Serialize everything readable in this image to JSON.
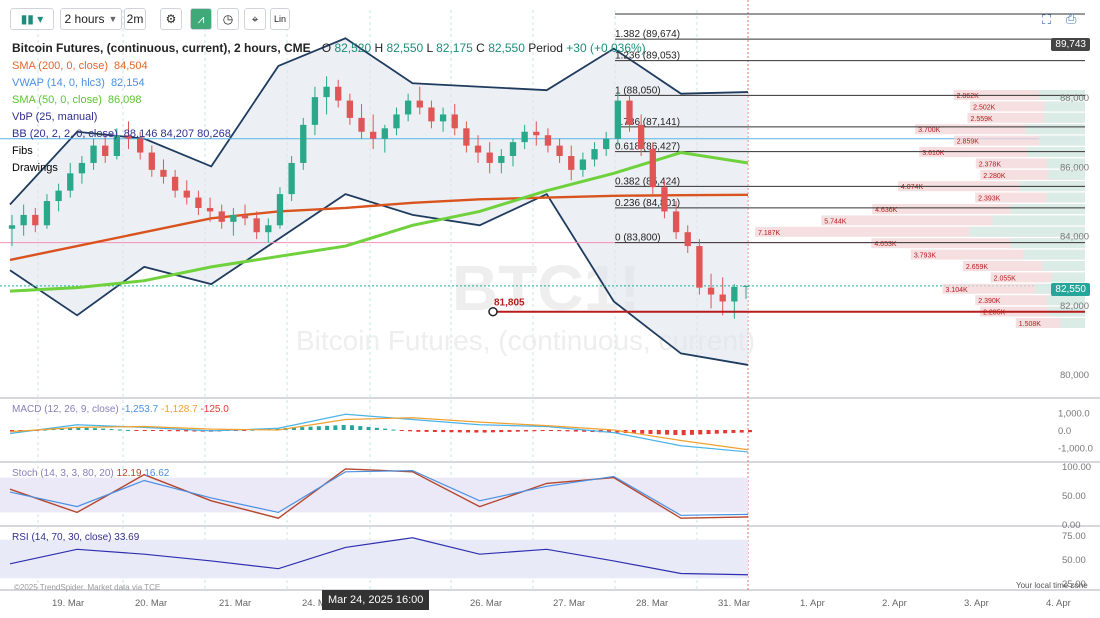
{
  "toolbar": {
    "interval_label": "2 hours",
    "interval2_label": "2m",
    "lin_label": "Lin"
  },
  "header": {
    "title": "Bitcoin Futures, (continuous, current), 2 hours, CME",
    "o_label": "O",
    "o": "82,520",
    "h_label": "H",
    "h": "82,550",
    "l_label": "L",
    "l": "82,175",
    "c_label": "C",
    "c": "82,550",
    "period_label": "Period",
    "period": "+30 (+0.036%)"
  },
  "legend": [
    {
      "name": "SMA (200, 0, close)",
      "values": "84,504",
      "color": "#e0662b"
    },
    {
      "name": "VWAP (14, 0, hlc3)",
      "values": "82,154",
      "color": "#4a90e2"
    },
    {
      "name": "SMA (50, 0, close)",
      "values": "86,098",
      "color": "#5cc431"
    },
    {
      "name": "VbP (25, manual)",
      "values": "",
      "color": "#2f2f8f"
    },
    {
      "name": "BB (20, 2, 2, 0, close)",
      "values": "88,146 84,207 80,268",
      "color": "#2f2f8f"
    },
    {
      "name": "Fibs",
      "values": "",
      "color": "#222222"
    },
    {
      "name": "Drawings",
      "values": "",
      "color": "#222222"
    }
  ],
  "watermark": {
    "symbol": "BTC1!",
    "name": "Bitcoin Futures, (continuous, current)"
  },
  "price_axis": {
    "ticks": [
      "88,000",
      "86,000",
      "84,000",
      "82,000",
      "80,000"
    ],
    "top_tag": "89,743",
    "last_tag": "82,550",
    "last_color": "#26a69a"
  },
  "fib_levels": [
    {
      "label": "1.382 (89,674)"
    },
    {
      "label": "1.236 (89,053)"
    },
    {
      "label": "1 (88,050)"
    },
    {
      "label": "0.786 (87,141)"
    },
    {
      "label": "0.618 (86,427)"
    },
    {
      "label": "0.382 (85,424)"
    },
    {
      "label": "0.236 (84,801)"
    },
    {
      "label": "0 (83,800)"
    }
  ],
  "drawing": {
    "label": "81,805",
    "color": "#b71c1c"
  },
  "vbp": [
    "2.862K",
    "2.502K",
    "2.559K",
    "3.700K",
    "2.859K",
    "3.610K",
    "2.378K",
    "2.280K",
    "4.074K",
    "2.393K",
    "4.636K",
    "5.744K",
    "7.187K",
    "4.653K",
    "3.793K",
    "2.659K",
    "2.055K",
    "3.104K",
    "2.390K",
    "2.285K",
    "1.508K"
  ],
  "macd": {
    "legend": "MACD (12, 26, 9, close)",
    "values": [
      "-1,253.7",
      "-1,128.7",
      "-125.0"
    ],
    "ticks": [
      "1,000.0",
      "0.0",
      "-1,000.0"
    ]
  },
  "stoch": {
    "legend": "Stoch (14, 3, 3, 80, 20)",
    "values": [
      "12.19",
      "16.62"
    ],
    "ticks": [
      "100.00",
      "50.00",
      "0.00"
    ]
  },
  "rsi": {
    "legend": "RSI (14, 70, 30, close)",
    "values": [
      "33.69"
    ],
    "ticks": [
      "75.00",
      "50.00",
      "25.00"
    ]
  },
  "x_axis": {
    "ticks": [
      "19. Mar",
      "20. Mar",
      "21. Mar",
      "24. Mar",
      "26. Mar",
      "27. Mar",
      "28. Mar",
      "31. Mar",
      "1. Apr",
      "2. Apr",
      "3. Apr",
      "4. Apr"
    ],
    "hover_date": "Mar 24, 2025 16:00"
  },
  "footer": {
    "credit": "©2025 TrendSpider. Market data via TCE",
    "timezone": "Your local time zone"
  },
  "chart_data": {
    "type": "line",
    "title": "Bitcoin Futures, (continuous, current), 2 hours, CME",
    "y_range": [
      79400,
      90400
    ],
    "candles_ohlc": [
      [
        84200,
        84600,
        83700,
        84300
      ],
      [
        84300,
        84900,
        84000,
        84600
      ],
      [
        84600,
        84800,
        84100,
        84300
      ],
      [
        84300,
        85200,
        84200,
        85000
      ],
      [
        85000,
        85500,
        84700,
        85300
      ],
      [
        85300,
        86100,
        85100,
        85800
      ],
      [
        85800,
        86300,
        85500,
        86100
      ],
      [
        86100,
        86800,
        85900,
        86600
      ],
      [
        86600,
        86900,
        86100,
        86300
      ],
      [
        86300,
        87100,
        86200,
        86900
      ],
      [
        86900,
        87300,
        86500,
        86800
      ],
      [
        86800,
        87000,
        86200,
        86400
      ],
      [
        86400,
        86600,
        85700,
        85900
      ],
      [
        85900,
        86200,
        85500,
        85700
      ],
      [
        85700,
        85900,
        85100,
        85300
      ],
      [
        85300,
        85600,
        84900,
        85100
      ],
      [
        85100,
        85300,
        84600,
        84800
      ],
      [
        84800,
        85100,
        84400,
        84700
      ],
      [
        84700,
        84900,
        84200,
        84400
      ],
      [
        84400,
        84800,
        84000,
        84600
      ],
      [
        84600,
        84900,
        84300,
        84500
      ],
      [
        84500,
        84700,
        83900,
        84100
      ],
      [
        84100,
        84500,
        83800,
        84300
      ],
      [
        84300,
        85400,
        84200,
        85200
      ],
      [
        85200,
        86300,
        85000,
        86100
      ],
      [
        86100,
        87400,
        85900,
        87200
      ],
      [
        87200,
        88300,
        86900,
        88000
      ],
      [
        88000,
        88600,
        87500,
        88300
      ],
      [
        88300,
        88500,
        87700,
        87900
      ],
      [
        87900,
        88100,
        87200,
        87400
      ],
      [
        87400,
        87800,
        86800,
        87000
      ],
      [
        87000,
        87500,
        86500,
        86800
      ],
      [
        86800,
        87200,
        86400,
        87100
      ],
      [
        87100,
        87700,
        86900,
        87500
      ],
      [
        87500,
        88100,
        87300,
        87900
      ],
      [
        87900,
        88300,
        87500,
        87700
      ],
      [
        87700,
        87900,
        87100,
        87300
      ],
      [
        87300,
        87700,
        87000,
        87500
      ],
      [
        87500,
        87800,
        86900,
        87100
      ],
      [
        87100,
        87300,
        86400,
        86600
      ],
      [
        86600,
        86900,
        86100,
        86400
      ],
      [
        86400,
        86700,
        85800,
        86100
      ],
      [
        86100,
        86500,
        85800,
        86300
      ],
      [
        86300,
        86800,
        86000,
        86700
      ],
      [
        86700,
        87200,
        86500,
        87000
      ],
      [
        87000,
        87300,
        86600,
        86900
      ],
      [
        86900,
        87100,
        86400,
        86600
      ],
      [
        86600,
        86800,
        86100,
        86300
      ],
      [
        86300,
        86600,
        85600,
        85900
      ],
      [
        85900,
        86400,
        85700,
        86200
      ],
      [
        86200,
        86700,
        86000,
        86500
      ],
      [
        86500,
        87000,
        86300,
        86800
      ],
      [
        86800,
        88100,
        86600,
        87900
      ],
      [
        87900,
        88050,
        87000,
        87200
      ],
      [
        87200,
        87500,
        86300,
        86500
      ],
      [
        86500,
        86700,
        85200,
        85400
      ],
      [
        85400,
        85600,
        84500,
        84700
      ],
      [
        84700,
        85000,
        83900,
        84100
      ],
      [
        84100,
        84300,
        83500,
        83700
      ],
      [
        83700,
        83900,
        82300,
        82500
      ],
      [
        82500,
        82900,
        81900,
        82300
      ],
      [
        82300,
        82800,
        81700,
        82100
      ],
      [
        82100,
        82600,
        81600,
        82520
      ],
      [
        82520,
        82550,
        82175,
        82550
      ]
    ],
    "sma200": [
      83300,
      83700,
      84100,
      84500,
      84700,
      84800,
      84950,
      85050,
      85100,
      85150,
      85170,
      85180
    ],
    "sma50": [
      82400,
      82500,
      82700,
      83100,
      83400,
      83700,
      84300,
      84700,
      85300,
      85800,
      86400,
      86098
    ],
    "bb_upper": [
      84900,
      87000,
      86800,
      86000,
      88900,
      89700,
      88400,
      88300,
      88200,
      89400,
      88100,
      88146
    ],
    "bb_lower": [
      83000,
      81700,
      83100,
      82600,
      83900,
      85200,
      84600,
      84300,
      85200,
      82100,
      80600,
      80268
    ],
    "macd_line": [
      -200,
      300,
      150,
      -50,
      100,
      900,
      600,
      300,
      200,
      -150,
      -900,
      -1253.7
    ],
    "signal_line": [
      -100,
      150,
      200,
      50,
      0,
      600,
      700,
      450,
      250,
      0,
      -600,
      -1128.7
    ],
    "stoch_k": [
      60,
      20,
      85,
      40,
      10,
      95,
      90,
      30,
      70,
      80,
      10,
      12.19
    ],
    "stoch_d": [
      55,
      30,
      75,
      45,
      20,
      90,
      92,
      40,
      65,
      82,
      15,
      16.62
    ],
    "rsi": [
      45,
      60,
      55,
      48,
      40,
      62,
      72,
      55,
      60,
      48,
      35,
      33.69
    ],
    "x_ticks": [
      "19. Mar",
      "20. Mar",
      "21. Mar",
      "24. Mar",
      "26. Mar",
      "27. Mar",
      "28. Mar",
      "31. Mar",
      "1. Apr",
      "2. Apr",
      "3. Apr",
      "4. Apr"
    ]
  }
}
